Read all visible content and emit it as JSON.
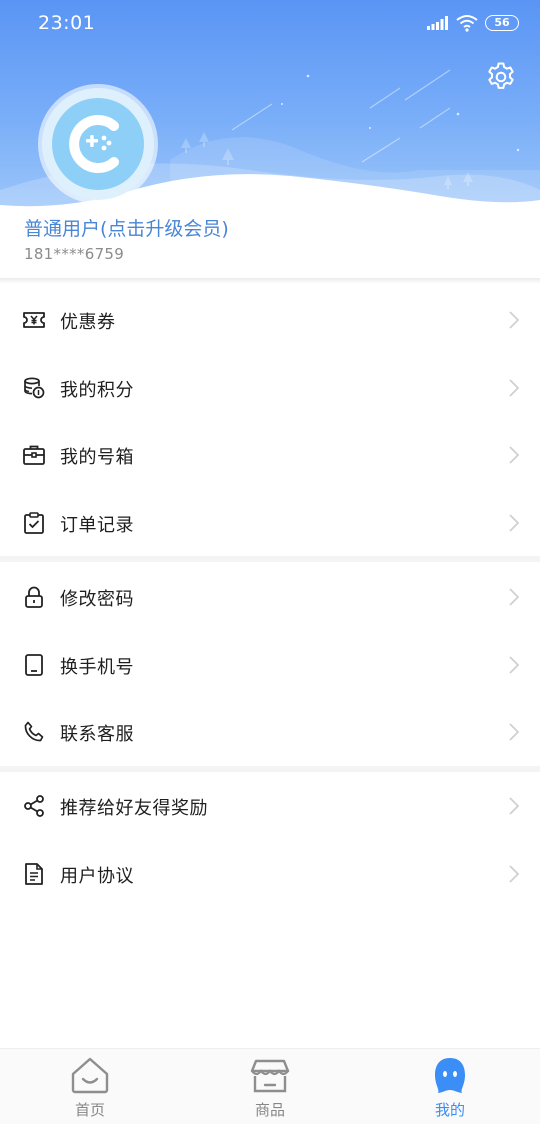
{
  "status_bar": {
    "time": "23:01",
    "battery": "56"
  },
  "header": {
    "settings_icon": "gear-icon"
  },
  "profile": {
    "avatar_icon": "gamepad-logo-icon",
    "name": "普通用户(点击升级会员)",
    "phone": "181****6759"
  },
  "menu_groups": [
    [
      {
        "label": "优惠券",
        "icon": "coupon-icon"
      },
      {
        "label": "我的积分",
        "icon": "coins-icon"
      },
      {
        "label": "我的号箱",
        "icon": "briefcase-icon"
      },
      {
        "label": "订单记录",
        "icon": "clipboard-check-icon"
      }
    ],
    [
      {
        "label": "修改密码",
        "icon": "lock-icon"
      },
      {
        "label": "换手机号",
        "icon": "tablet-icon"
      },
      {
        "label": "联系客服",
        "icon": "phone-icon"
      }
    ],
    [
      {
        "label": "推荐给好友得奖励",
        "icon": "share-icon"
      },
      {
        "label": "用户协议",
        "icon": "document-icon"
      }
    ]
  ],
  "tabs": [
    {
      "label": "首页",
      "icon": "home-icon",
      "active": false
    },
    {
      "label": "商品",
      "icon": "store-icon",
      "active": false
    },
    {
      "label": "我的",
      "icon": "profile-icon",
      "active": true
    }
  ],
  "colors": {
    "accent": "#3a8ef5",
    "header_top": "#5a95f5",
    "name_text": "#4a86d8"
  }
}
